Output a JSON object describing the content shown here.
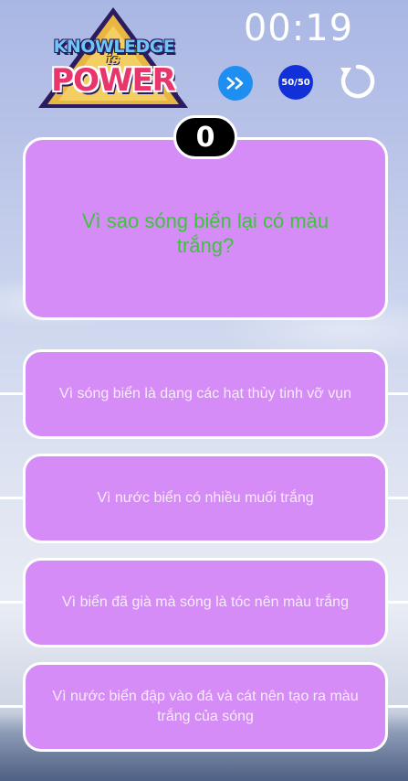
{
  "logo": {
    "line1": "KNOWLEDGE",
    "line2": "is",
    "line3": "POWER"
  },
  "timer": "00:19",
  "buttons": {
    "skip_icon": "fast-forward-icon",
    "fifty_label": "50/50",
    "restart_icon": "restart-icon"
  },
  "score": "0",
  "question": "Vì sao sóng biển lại có màu trắng?",
  "answers": [
    "Vì sóng biển là dạng các hạt thủy tinh vỡ vụn",
    "Vì nước biển có nhiều muối trắng",
    "Vì biển đã già mà sóng là tóc nên màu trắng",
    "Vì nước biển đập vào đá và cát nên tạo ra màu trắng của sóng"
  ],
  "colors": {
    "card": "#d68cf6",
    "question_text": "#3cc43a",
    "skip_button": "#1e8ff0",
    "fifty_button": "#1230d8"
  }
}
